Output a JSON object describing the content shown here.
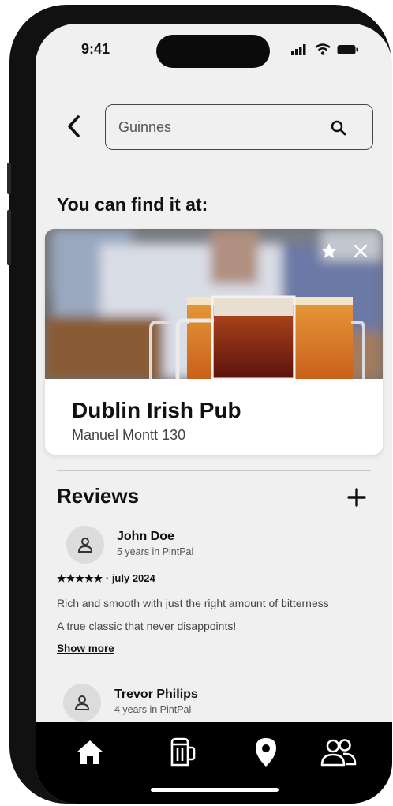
{
  "status_bar": {
    "time": "9:41"
  },
  "search": {
    "value": "Guinnes",
    "placeholder": "Search"
  },
  "section_title": "You can find it at:",
  "place": {
    "name": "Dublin Irish Pub",
    "address": "Manuel Montt 130"
  },
  "reviews": {
    "title": "Reviews",
    "items": [
      {
        "name": "John Doe",
        "tenure": "5 years in PintPal",
        "meta": "★★★★★ · july 2024",
        "text_lines": [
          "Rich and smooth with just the right amount of bitterness",
          "A true classic that never disappoints!"
        ],
        "show_more": "Show more"
      },
      {
        "name": "Trevor Philips",
        "tenure": "4 years in PintPal"
      }
    ]
  },
  "nav": [
    "home-icon",
    "beer-mug-icon",
    "location-pin-icon",
    "friends-icon"
  ],
  "colors": {
    "screen_bg": "#f0f0f0",
    "nav_bg": "#000000",
    "accent": "#111111"
  }
}
